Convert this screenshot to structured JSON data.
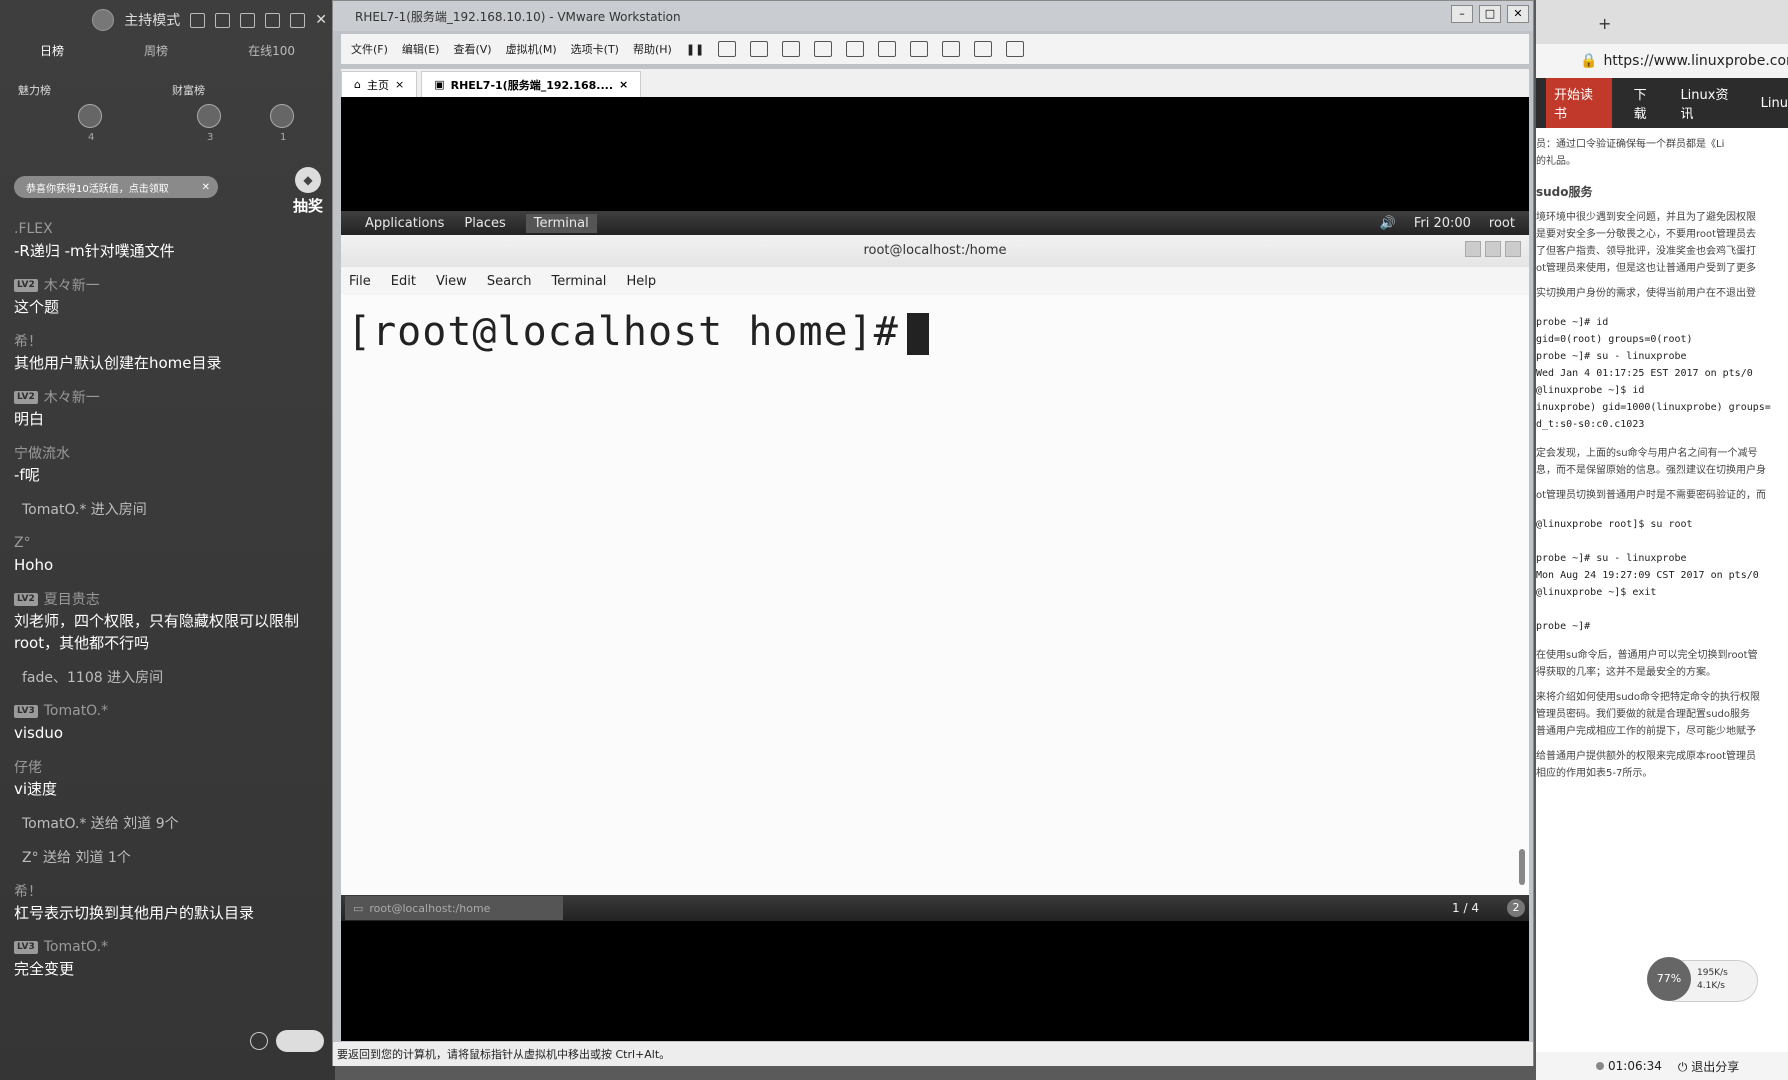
{
  "chat": {
    "mode_label": "主持模式",
    "ranking_tabs": [
      "日榜",
      "周榜",
      "在线100"
    ],
    "charm_label": "魅力榜",
    "wealth_label": "财富榜",
    "rank_numbers": [
      "4",
      "3",
      "1"
    ],
    "notice": "恭喜你获得10活跃值，点击领取",
    "lottery": "抽奖",
    "messages": [
      {
        "user": ".FLEX",
        "level": "",
        "text": "-R递归 -m针对噗通文件"
      },
      {
        "user": "木々新一",
        "level": "LV2",
        "text": "这个题"
      },
      {
        "user": "希！",
        "level": "",
        "text": "其他用户默认创建在home目录"
      },
      {
        "user": "木々新一",
        "level": "LV2",
        "text": "明白"
      },
      {
        "user": "宁做流水",
        "level": "",
        "text": "-f呢"
      },
      {
        "user": "TomatO.* 进入房间",
        "level": "",
        "text": "",
        "system": true
      },
      {
        "user": "Z°",
        "level": "",
        "text": "Hoho"
      },
      {
        "user": "夏目贵志",
        "level": "LV2",
        "text": "刘老师，四个权限，只有隐藏权限可以限制root，其他都不行吗"
      },
      {
        "user": "fade、1108 进入房间",
        "level": "",
        "text": "",
        "system": true
      },
      {
        "user": "TomatO.*",
        "level": "LV3",
        "text": "visduo"
      },
      {
        "user": "仔佬",
        "level": "",
        "text": "vi速度"
      },
      {
        "user": "TomatO.* 送给 刘道 9个",
        "level": "",
        "text": "",
        "system": true
      },
      {
        "user": "Z° 送给 刘道 1个",
        "level": "",
        "text": "",
        "system": true
      },
      {
        "user": "希！",
        "level": "",
        "text": "杠号表示切换到其他用户的默认目录"
      },
      {
        "user": "TomatO.*",
        "level": "LV3",
        "text": "完全变更"
      }
    ]
  },
  "vm": {
    "title": "RHEL7-1(服务端_192.168.10.10) - VMware Workstation",
    "menus": [
      "文件(F)",
      "编辑(E)",
      "查看(V)",
      "虚拟机(M)",
      "选项卡(T)",
      "帮助(H)"
    ],
    "tab_home": "主页",
    "tab_vm": "RHEL7-1(服务端_192.168....",
    "status": "要返回到您的计算机，请将鼠标指针从虚拟机中移出或按 Ctrl+Alt。",
    "gnome": {
      "applications": "Applications",
      "places": "Places",
      "terminal": "Terminal",
      "clock": "Fri 20:00",
      "user": "root"
    },
    "terminal": {
      "title": "root@localhost:/home",
      "menus": [
        "File",
        "Edit",
        "View",
        "Search",
        "Terminal",
        "Help"
      ],
      "prompt": "[root@localhost home]#",
      "task": "root@localhost:/home",
      "pager": "1 / 4",
      "badge": "2"
    }
  },
  "browser": {
    "url": "https://www.linuxprobe.com/c",
    "nav": [
      "开始读书",
      "下载",
      "Linux资讯",
      "Linu"
    ],
    "lines_top": [
      "员：通过口令验证确保每一个群员都是《Li",
      "的礼品。"
    ],
    "heading": "sudo服务",
    "para1": [
      "境环境中很少遇到安全问题，并且为了避免因权限",
      "是要对安全多一分敬畏之心，不要用root管理员去",
      "了但客户指责、领导批评，没准奖金也会鸡飞蛋打",
      "ot管理员来使用，但是这也让普通用户受到了更多"
    ],
    "para2": "实切换用户身份的需求，使得当前用户在不退出登",
    "code1": [
      "probe ~]# id",
      "gid=0(root) groups=0(root)",
      "probe ~]# su - linuxprobe",
      "Wed Jan 4 01:17:25 EST 2017 on pts/0",
      "@linuxprobe ~]$ id",
      "inuxprobe) gid=1000(linuxprobe) groups=",
      "d_t:s0-s0:c0.c1023"
    ],
    "para3": [
      "定会发现，上面的su命令与用户名之间有一个减号",
      "息，而不是保留原始的信息。强烈建议在切换用户身"
    ],
    "para4": "ot管理员切换到普通用户时是不需要密码验证的，而",
    "code2": [
      "@linuxprobe root]$ su root",
      "",
      "probe ~]# su - linuxprobe",
      "Mon Aug 24 19:27:09 CST 2017 on pts/0",
      "@linuxprobe ~]$ exit",
      "",
      "probe ~]#"
    ],
    "para5": [
      "在使用su命令后，普通用户可以完全切换到root管",
      "得获取的几率；这并不是最安全的方案。"
    ],
    "para6": [
      "来将介绍如何使用sudo命令把特定命令的执行权限",
      "管理员密码。我们要做的就是合理配置sudo服务",
      "普通用户完成相应工作的前提下，尽可能少地赋予"
    ],
    "para7": [
      "给普通用户提供额外的权限来完成原本root管理员",
      "相应的作用如表5-7所示。"
    ],
    "speed_pct": "77%",
    "speed_up": "195K/s",
    "speed_down": "4.1K/s",
    "timer": "01:06:34",
    "exit_share": "退出分享"
  }
}
